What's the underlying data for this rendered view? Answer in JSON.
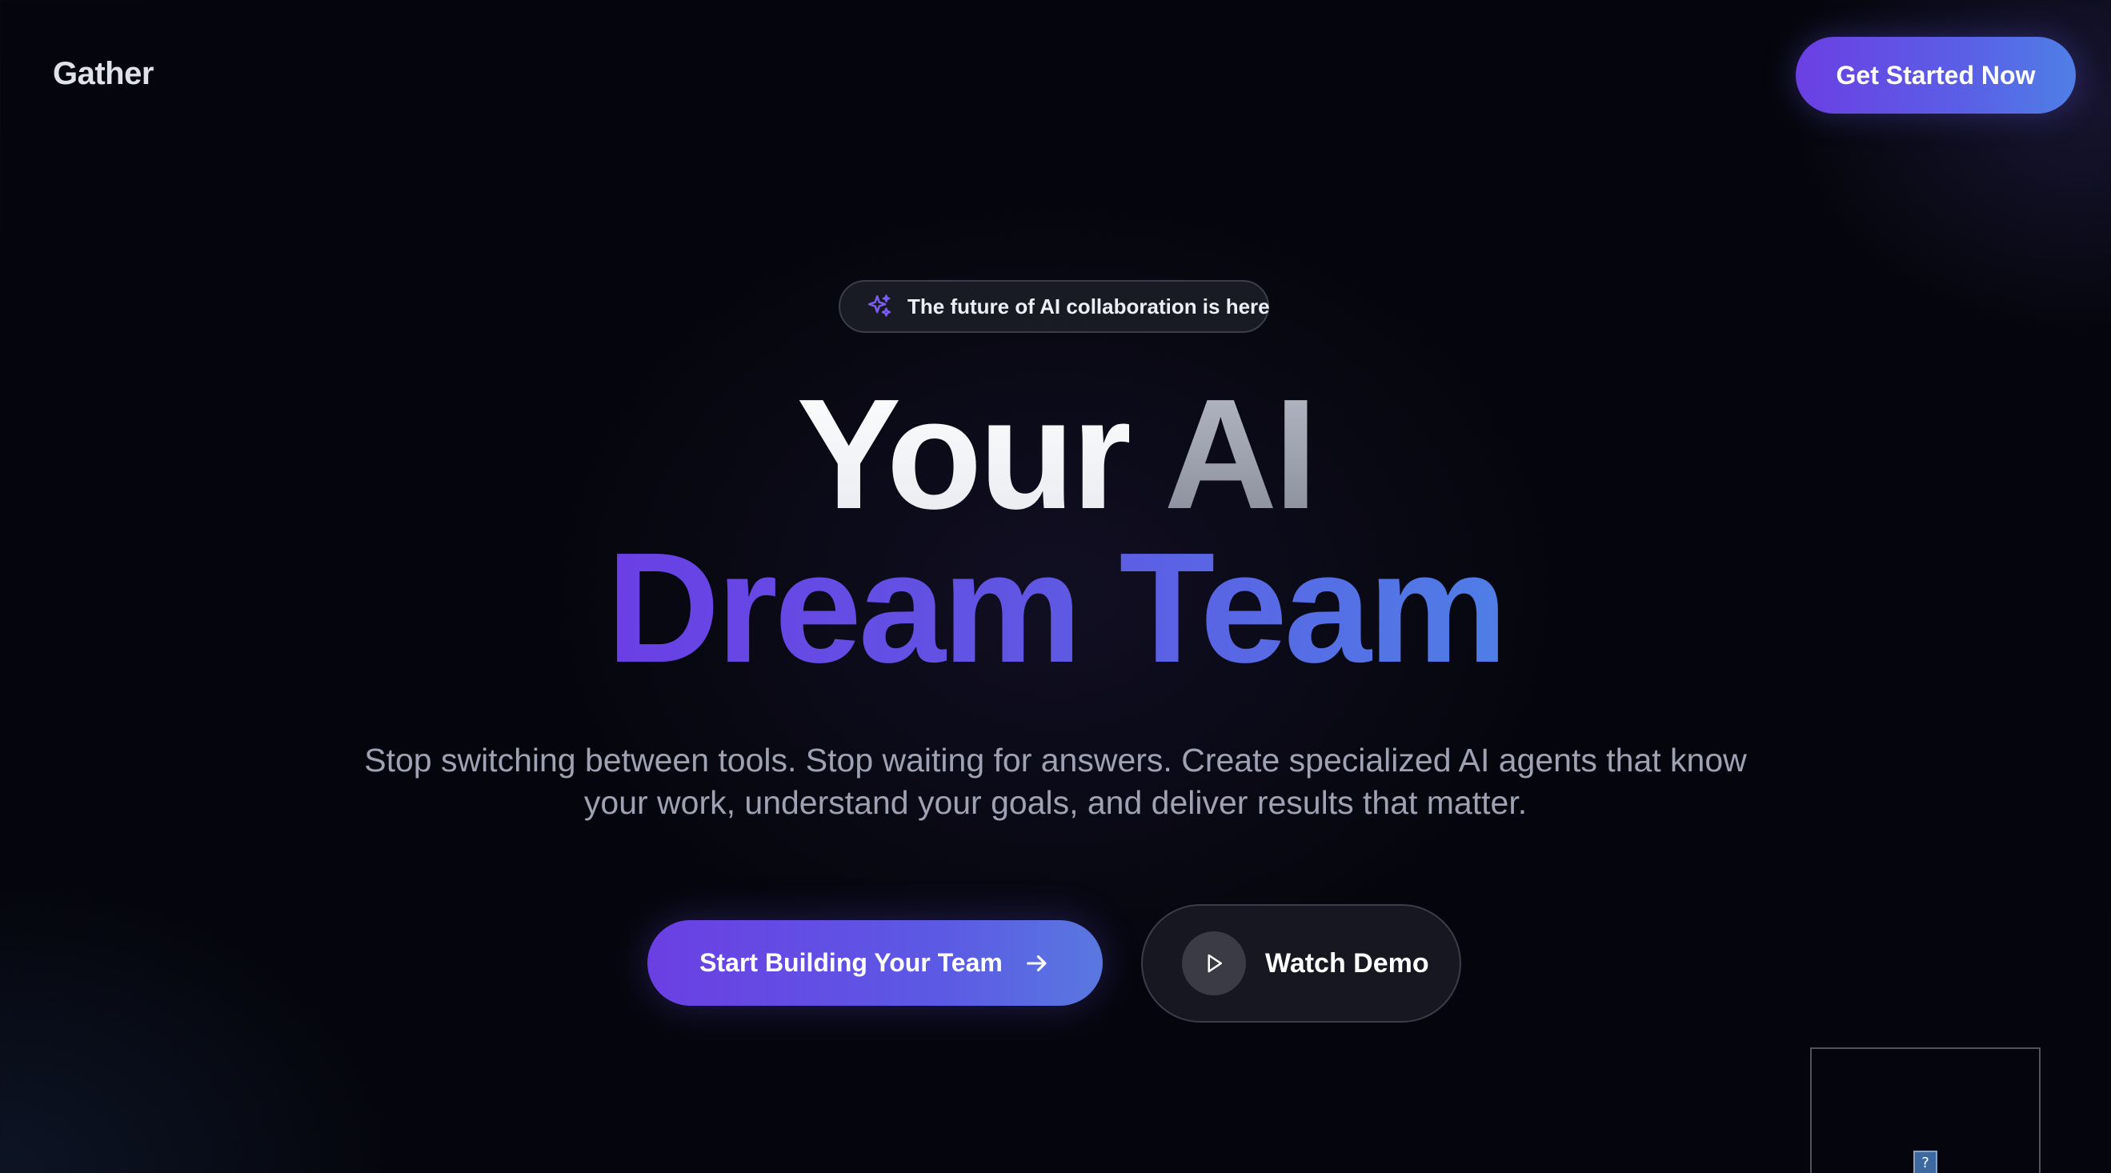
{
  "header": {
    "logo": "Gather",
    "cta_label": "Get Started Now"
  },
  "hero": {
    "badge": {
      "icon": "sparkle-icon",
      "text": "The future of AI collaboration is here"
    },
    "headline": {
      "line1_word1": "Your",
      "line1_word2": "AI",
      "line2": "Dream Team"
    },
    "subtitle_line1": "Stop switching between tools. Stop waiting for answers. Create specialized AI agents that know",
    "subtitle_line2": "your work, understand your goals, and deliver results that matter.",
    "primary_button": {
      "label": "Start Building Your Team",
      "icon": "arrow-right-icon"
    },
    "secondary_button": {
      "label": "Watch Demo",
      "icon": "play-icon"
    }
  },
  "embed": {
    "icon": "broken-image-icon",
    "glyph": "?"
  },
  "colors": {
    "background": "#05060d",
    "accent_purple": "#6b3fe3",
    "accent_blue": "#4f7fe6",
    "subtitle_text": "#9ea2b2"
  }
}
